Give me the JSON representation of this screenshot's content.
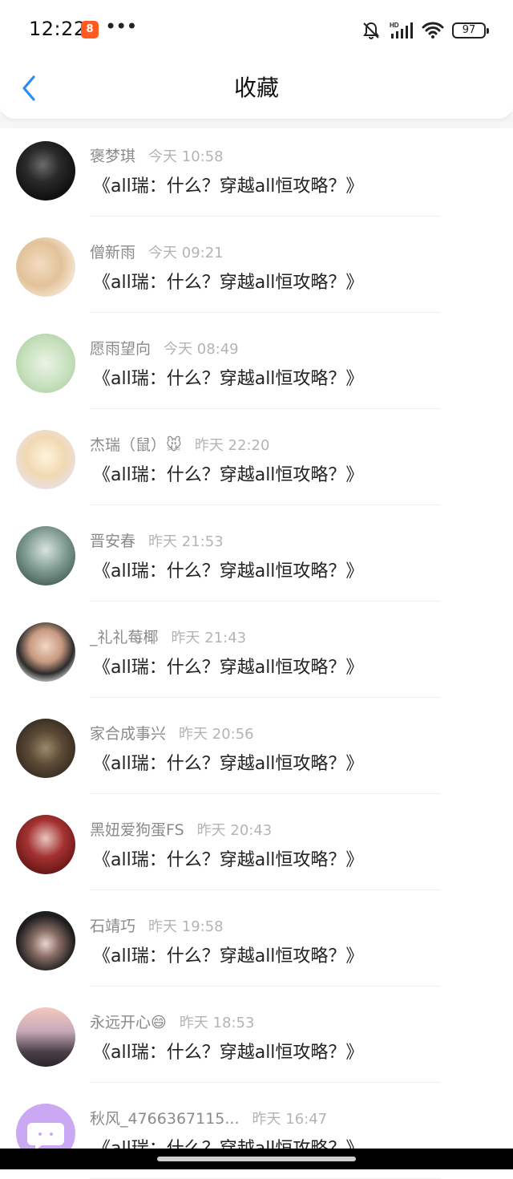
{
  "status": {
    "time": "12:22",
    "app_badge": "8",
    "more": "•••",
    "battery": "97",
    "hd": "HD"
  },
  "header": {
    "title": "收藏"
  },
  "items": [
    {
      "name": "褒梦琪",
      "time": "今天 10:58",
      "message": "《all瑞：什么？穿越all恒攻略？》",
      "avatar_color": "#1b1b1b"
    },
    {
      "name": "僧新雨",
      "time": "今天 09:21",
      "message": "《all瑞：什么？穿越all恒攻略？》",
      "avatar_color": "#e8cfa8"
    },
    {
      "name": "愿雨望向",
      "time": "今天 08:49",
      "message": "《all瑞：什么？穿越all恒攻略？》",
      "avatar_color": "#cfe6c9"
    },
    {
      "name": "杰瑞（鼠）🐭",
      "time": "昨天 22:20",
      "message": "《all瑞：什么？穿越all恒攻略？》",
      "avatar_color": "#f1e2c6"
    },
    {
      "name": "晋安春",
      "time": "昨天 21:53",
      "message": "《all瑞：什么？穿越all恒攻略？》",
      "avatar_color": "#5f7a6e"
    },
    {
      "name": "_礼礼莓椰",
      "time": "昨天 21:43",
      "message": "《all瑞：什么？穿越all恒攻略？》",
      "avatar_color": "#d7c2b0"
    },
    {
      "name": "家合成事兴",
      "time": "昨天 20:56",
      "message": "《all瑞：什么？穿越all恒攻略？》",
      "avatar_color": "#4a3b2e"
    },
    {
      "name": "黑妞爱狗蛋FS",
      "time": "昨天 20:43",
      "message": "《all瑞：什么？穿越all恒攻略？》",
      "avatar_color": "#7a1c1c"
    },
    {
      "name": "石靖巧",
      "time": "昨天 19:58",
      "message": "《all瑞：什么？穿越all恒攻略？》",
      "avatar_color": "#2a2a2a"
    },
    {
      "name": "永远开心😄",
      "time": "昨天 18:53",
      "message": "《all瑞：什么？穿越all恒攻略？》",
      "avatar_color": "#8b7d86"
    },
    {
      "name": "秋风_4766367115...",
      "time": "昨天 16:47",
      "message": "《all瑞：什么？穿越all恒攻略？》",
      "avatar_color": "#c9a6f2"
    }
  ]
}
